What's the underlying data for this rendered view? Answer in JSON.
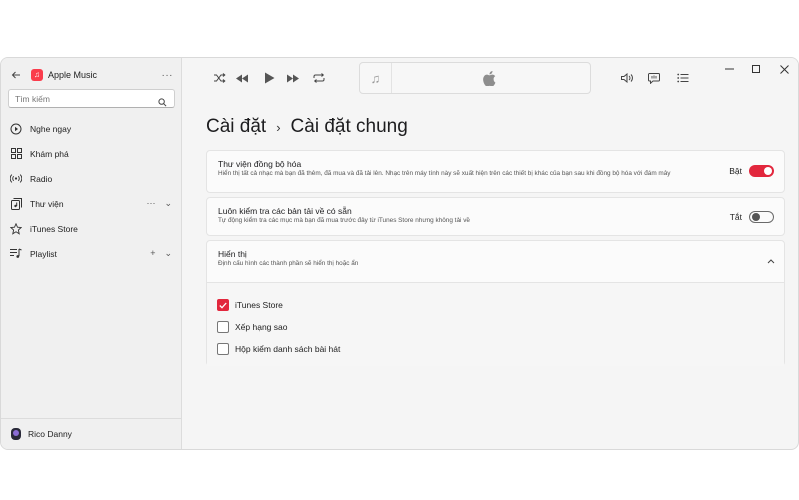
{
  "app": {
    "name": "Apple Music",
    "more": "···"
  },
  "search": {
    "placeholder": "Tìm kiếm"
  },
  "sidebar": {
    "items": [
      {
        "label": "Nghe ngay",
        "icon": "play-circle-icon"
      },
      {
        "label": "Khám phá",
        "icon": "grid-icon"
      },
      {
        "label": "Radio",
        "icon": "radio-icon"
      },
      {
        "label": "Thư viện",
        "icon": "library-icon",
        "more": "···",
        "chevron": "⌄"
      },
      {
        "label": "iTunes Store",
        "icon": "star-icon"
      },
      {
        "label": "Playlist",
        "icon": "playlist-icon",
        "add": "+",
        "chevron": "⌄"
      }
    ],
    "user": {
      "name": "Rico Danny"
    }
  },
  "toolbar": {
    "controls": [
      "shuffle-icon",
      "previous-icon",
      "play-icon",
      "next-icon",
      "repeat-icon"
    ],
    "right": [
      "volume-icon",
      "lyrics-icon",
      "queue-icon"
    ]
  },
  "page": {
    "breadcrumb_parent": "Cài đặt",
    "breadcrumb_sep": "›",
    "title": "Cài đặt chung"
  },
  "settings": {
    "sync": {
      "title": "Thư viện đồng bộ hóa",
      "desc": "Hiển thị tất cả nhạc mà bạn đã thêm, đã mua và đã tải lên. Nhạc trên máy tính này sẽ xuất hiện trên các thiết bị khác của bạn sau khi đồng bộ hóa với đám mây",
      "state_label": "Bật",
      "on": true
    },
    "downloads": {
      "title": "Luôn kiểm tra các bản tải về có sẵn",
      "desc": "Tự động kiểm tra các mục mà bạn đã mua trước đây từ iTunes Store nhưng không tải về",
      "state_label": "Tắt",
      "on": false
    },
    "display": {
      "title": "Hiển thị",
      "desc": "Định cấu hình các thành phần sẽ hiển thị hoặc ẩn",
      "options": [
        {
          "label": "iTunes Store",
          "checked": true
        },
        {
          "label": "Xếp hạng sao",
          "checked": false
        },
        {
          "label": "Hộp kiểm danh sách bài hát",
          "checked": false
        }
      ]
    }
  },
  "colors": {
    "accent": "#e2273d",
    "sidebar_bg": "#f0f0f0",
    "content_bg": "#f5f5f5"
  }
}
